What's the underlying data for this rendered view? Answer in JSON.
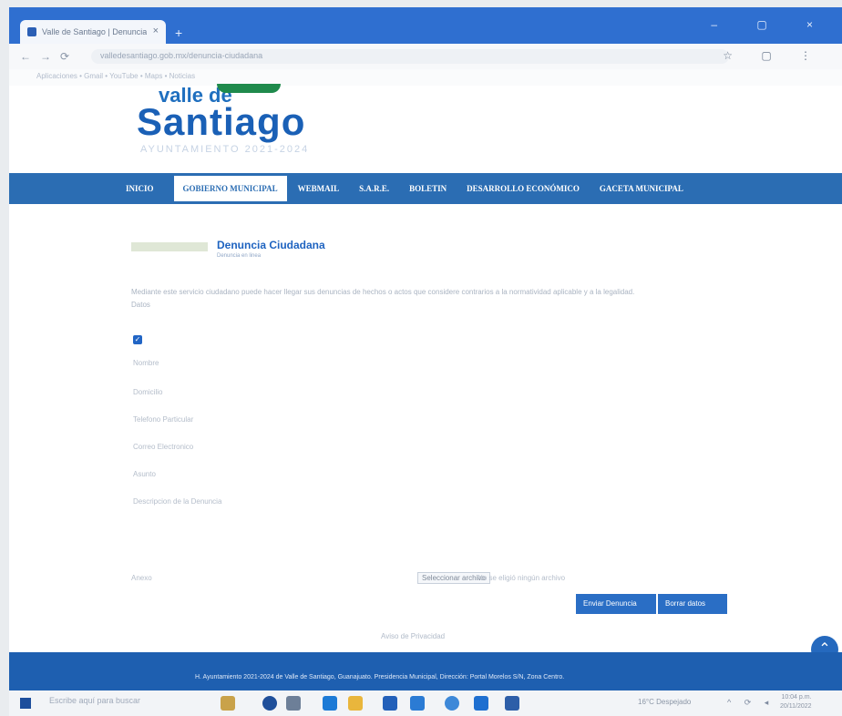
{
  "browser": {
    "tab_title": "Valle de Santiago | Denuncia",
    "url": "valledesantiago.gob.mx/denuncia-ciudadana",
    "bookmarks": "Aplicaciones   •   Gmail   •   YouTube   •   Maps   •   Noticias"
  },
  "site": {
    "logo_valle": "valle de",
    "logo_santiago": "Santiago",
    "logo_sub": "AYUNTAMIENTO 2021-2024"
  },
  "menu": {
    "items": [
      "INICIO",
      "GOBIERNO MUNICIPAL",
      "WEBMAIL",
      "S.A.R.E.",
      "BOLETIN",
      "DESARROLLO ECONÓMICO",
      "GACETA MUNICIPAL"
    ]
  },
  "page": {
    "heading": "Denuncia Ciudadana",
    "heading_sub": "Denuncia en linea",
    "intro_line1": "Mediante este servicio ciudadano puede hacer llegar sus denuncias de hechos o actos que considere contrarios a la normatividad aplicable y a la legalidad.",
    "intro_line2": "Datos",
    "field_labels": [
      "Nombre",
      "Domicilio",
      "Telefono Particular",
      "Correo Electronico",
      "Asunto",
      "Descripcion de la Denuncia"
    ],
    "file_label": "Anexo",
    "file_button": "Seleccionar archivo",
    "file_status": "No se eligió ningún archivo",
    "send_button": "Enviar Denuncia",
    "clear_button": "Borrar datos",
    "footer_link": "Aviso de Privacidad"
  },
  "footer": {
    "text": "H. Ayuntamiento 2021-2024 de Valle de Santiago, Guanajuato. Presidencia Municipal, Dirección: Portal Morelos S/N, Zona Centro."
  },
  "taskbar": {
    "search_placeholder": "Escribe aquí para buscar",
    "weather": "16°C Despejado",
    "time": "10:04 p.m.",
    "date": "20/11/2022"
  }
}
